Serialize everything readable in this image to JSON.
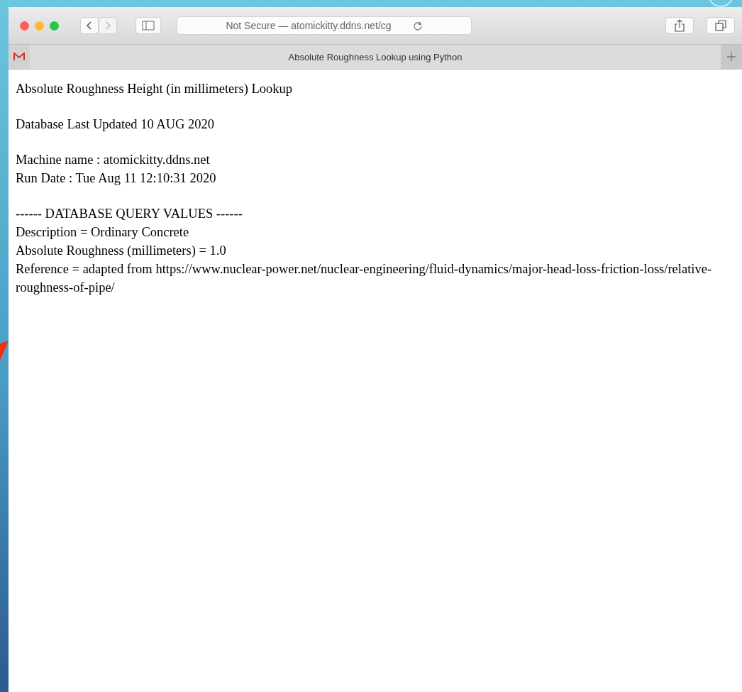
{
  "browser": {
    "address": "Not Secure — atomickitty.ddns.net/cg",
    "tabs": [
      {
        "title": "Absolute Roughness Lookup using Python",
        "selected": true
      }
    ]
  },
  "page": {
    "blocks": [
      {
        "lines": [
          "Absolute Roughness Height (in millimeters) Lookup"
        ]
      },
      {
        "lines": [
          "Database Last Updated 10 AUG 2020"
        ]
      },
      {
        "lines": [
          "Machine name : atomickitty.ddns.net",
          "Run Date : Tue Aug 11 12:10:31 2020"
        ]
      },
      {
        "lines": [
          "------ DATABASE QUERY VALUES ------",
          "Description = Ordinary Concrete",
          "Absolute Roughness (millimeters) = 1.0",
          "Reference = adapted from https://www.nuclear-power.net/nuclear-engineering/fluid-dynamics/major-head-loss-friction-loss/relative-roughness-of-pipe/"
        ]
      }
    ]
  }
}
